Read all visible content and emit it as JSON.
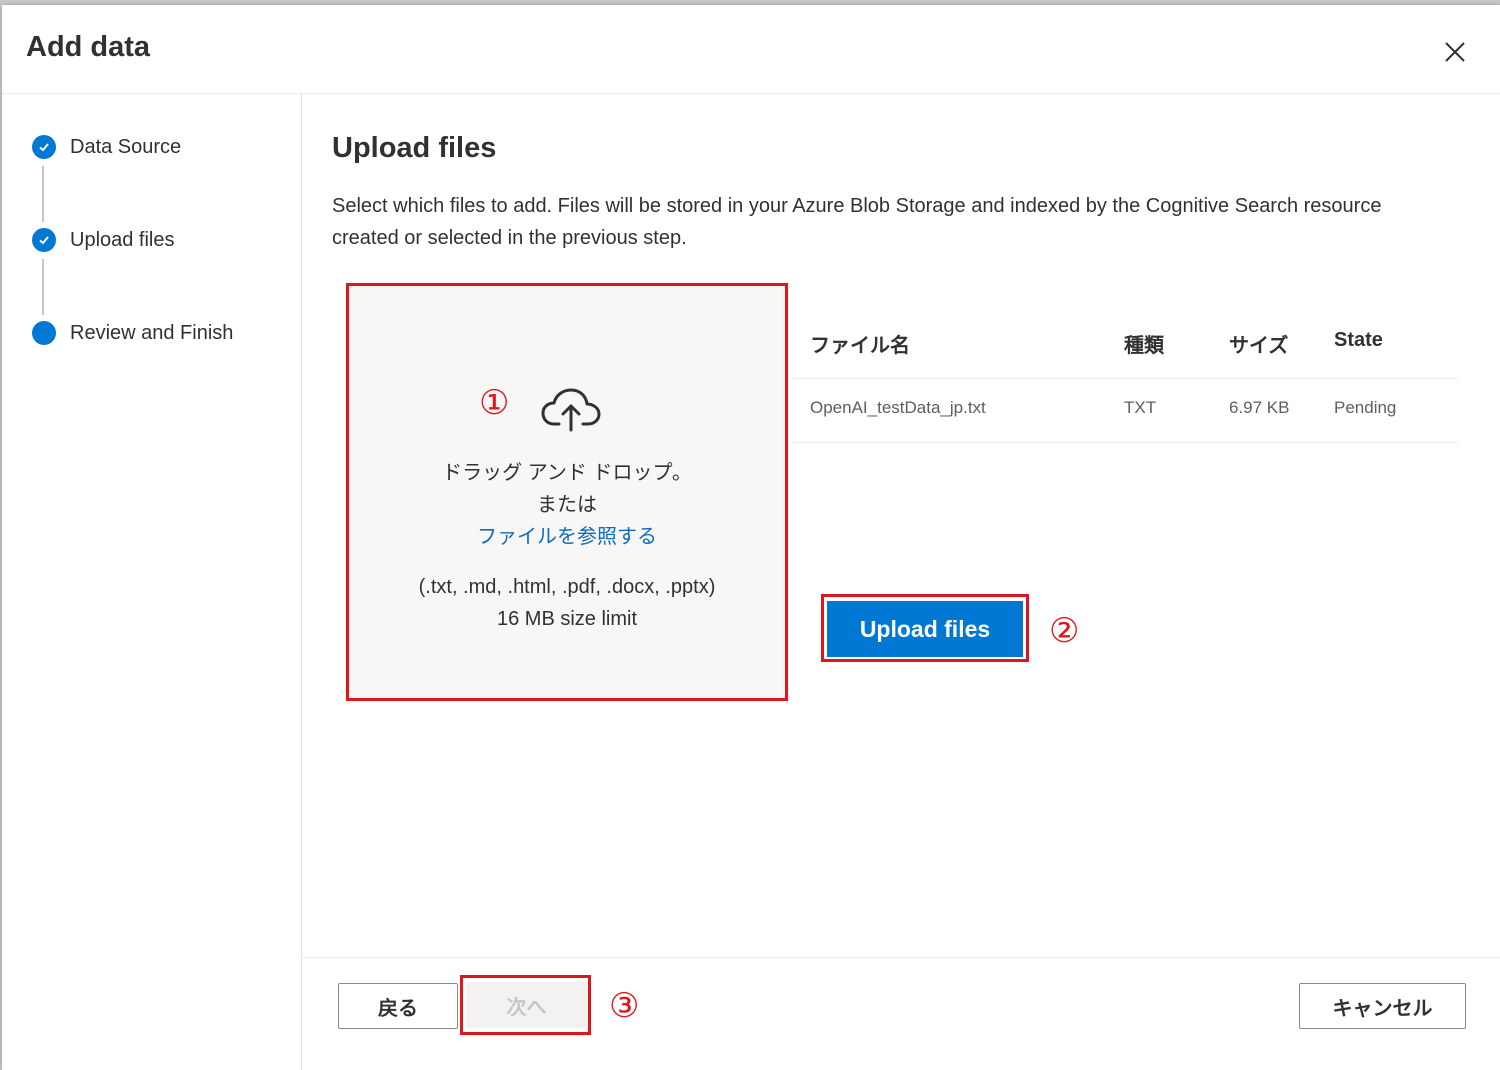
{
  "dialog": {
    "title": "Add data",
    "close_icon": "close-icon"
  },
  "steps": [
    {
      "label": "Data Source",
      "status": "completed",
      "icon": "checkmark-icon"
    },
    {
      "label": "Upload files",
      "status": "completed",
      "icon": "checkmark-icon"
    },
    {
      "label": "Review and Finish",
      "status": "current",
      "icon": "filled-circle-icon"
    }
  ],
  "main": {
    "heading": "Upload files",
    "description": "Select which files to add. Files will be stored in your Azure Blob Storage and indexed by the Cognitive Search resource created or selected in the previous step."
  },
  "dropzone": {
    "annotation": "①",
    "icon": "cloud-upload-icon",
    "drag_text": "ドラッグ アンド ドロップ。",
    "or_text": "または",
    "browse_link": "ファイルを参照する",
    "formats": "(.txt, .md, .html, .pdf, .docx, .pptx)",
    "size_limit": "16 MB size limit"
  },
  "file_table": {
    "columns": [
      "ファイル名",
      "種類",
      "サイズ",
      "State"
    ],
    "rows": [
      [
        "OpenAI_testData_jp.txt",
        "TXT",
        "6.97 KB",
        "Pending"
      ]
    ]
  },
  "upload": {
    "button_label": "Upload files",
    "annotation": "②"
  },
  "footer": {
    "back_label": "戻る",
    "next_label": "次へ",
    "next_annotation": "③",
    "cancel_label": "キャンセル"
  },
  "colors": {
    "accent": "#0078d4",
    "annotation_red": "#e0161e",
    "link": "#0f6cbd"
  }
}
